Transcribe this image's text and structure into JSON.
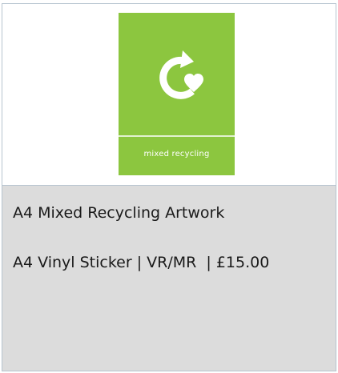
{
  "product": {
    "image": {
      "icon": "recycling-loop-heart-icon",
      "label": "mixed recycling",
      "background_color": "#8cc63f",
      "foreground_color": "#ffffff"
    },
    "title": "A4 Mixed Recycling Artwork",
    "details": "A4 Vinyl Sticker | VR/MR  | £15.00"
  },
  "colors": {
    "card_border": "#b7c4d0",
    "info_background": "#dcdcdc",
    "text": "#1a1a1a"
  }
}
